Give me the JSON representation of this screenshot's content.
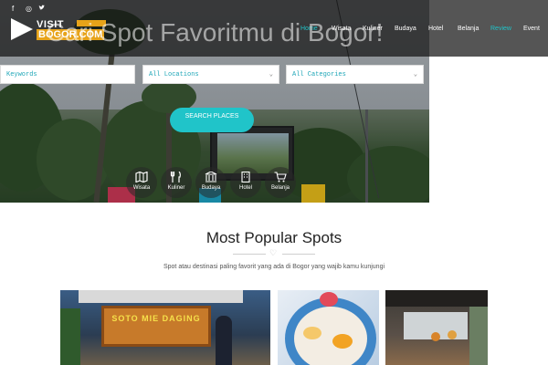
{
  "social": {
    "icons": [
      "facebook-icon",
      "instagram-icon",
      "twitter-icon"
    ],
    "glyphs": [
      "f",
      "◎",
      "🐦"
    ]
  },
  "logo": {
    "line1": "VISIT",
    "line2": "BOGOR.COM"
  },
  "nav": [
    "Home",
    "Wisata",
    "Kuliner",
    "Budaya",
    "Hotel",
    "Belanja",
    "Review",
    "Event"
  ],
  "nav_active": "Review",
  "hero": {
    "title": "Cari Spot Favoritmu di Bogor!"
  },
  "search": {
    "keywords_placeholder": "Keywords",
    "location_value": "All Locations",
    "category_value": "All Categories",
    "button_label": "SEARCH PLACES"
  },
  "categories": [
    "Wisata",
    "Kuliner",
    "Budaya",
    "Hotel",
    "Belanja"
  ],
  "popular": {
    "title": "Most Popular Spots",
    "subtitle": "Spot atau destinasi paling favorit yang ada di Bogor yang wajib kamu kunjungi"
  },
  "cards": [
    {
      "sign_text": "SOTO MIE DAGING"
    },
    {
      "sign_text": ""
    },
    {
      "sign_text": ""
    }
  ],
  "colors": {
    "accent": "#20c4c9",
    "logo_orange": "#e7a319"
  }
}
